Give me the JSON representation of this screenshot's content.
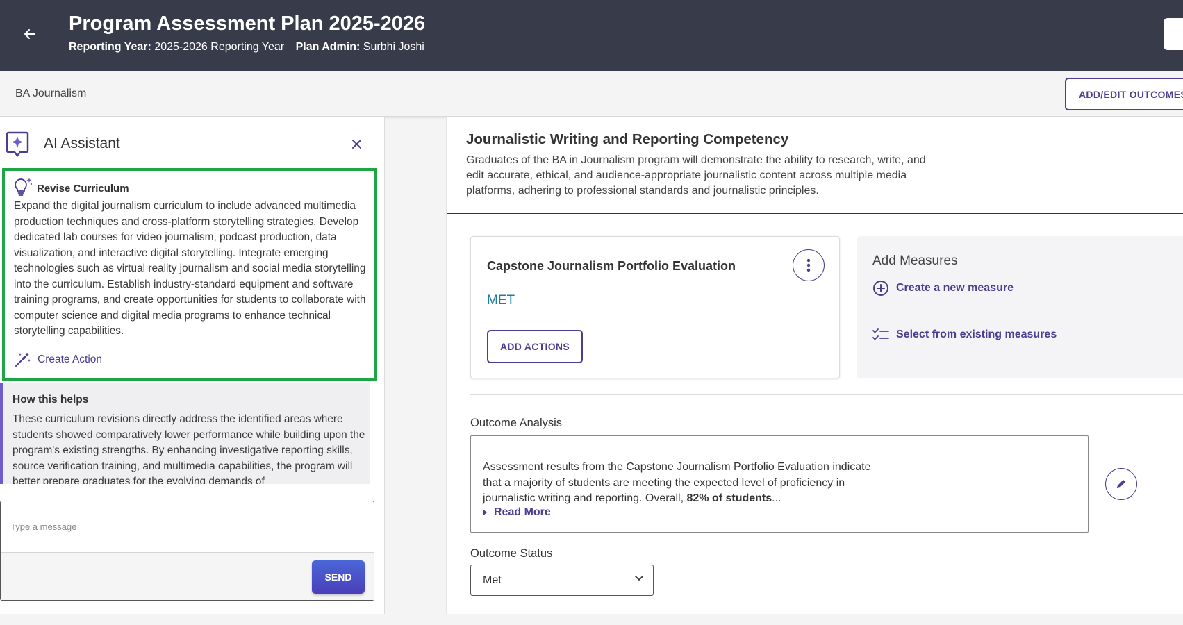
{
  "header": {
    "title": "Program Assessment Plan 2025-2026",
    "reporting_year_label": "Reporting Year:",
    "reporting_year_value": "2025-2026 Reporting Year",
    "plan_admin_label": "Plan Admin:",
    "plan_admin_value": "Surbhi Joshi"
  },
  "subbar": {
    "program_name": "BA Journalism",
    "add_edit_outcomes_label": "ADD/EDIT OUTCOMES"
  },
  "ai_panel": {
    "title": "AI Assistant",
    "suggestion": {
      "title": "Revise Curriculum",
      "body": "Expand the digital journalism curriculum to include advanced multimedia production techniques and cross-platform storytelling strategies. Develop dedicated lab courses for video journalism, podcast production, data visualization, and interactive digital storytelling. Integrate emerging technologies such as virtual reality journalism and social media storytelling into the curriculum. Establish industry-standard equipment and software training programs, and create opportunities for students to collaborate with computer science and digital media programs to enhance technical storytelling capabilities.",
      "create_action_label": "Create Action"
    },
    "helps": {
      "title": "How this helps",
      "body": "These curriculum revisions directly address the identified areas where students showed comparatively lower performance while building upon the program's existing strengths. By enhancing investigative reporting skills, source verification training, and multimedia capabilities, the program will better prepare graduates for the evolving demands of"
    },
    "message": {
      "placeholder": "Type a message",
      "send_label": "SEND"
    }
  },
  "outcome": {
    "title": "Journalistic Writing and Reporting Competency",
    "description": "Graduates of the BA in Journalism program will demonstrate the ability to research, write, and edit accurate, ethical, and audience-appropriate journalistic content across multiple media platforms, adhering to professional standards and journalistic principles."
  },
  "measure": {
    "title": "Capstone Journalism Portfolio Evaluation",
    "status": "MET",
    "add_actions_label": "ADD ACTIONS"
  },
  "add_measures": {
    "title": "Add Measures",
    "create_label": "Create a new measure",
    "select_label": "Select from existing measures"
  },
  "analysis": {
    "label": "Outcome Analysis",
    "text_start": "Assessment results from the Capstone Journalism Portfolio Evaluation indicate that a majority of students are meeting the expected level of proficiency in journalistic writing and reporting. Overall, ",
    "text_bold": "82% of students",
    "text_ellipsis": "...",
    "read_more_label": "Read More"
  },
  "outcome_status": {
    "label": "Outcome Status",
    "selected": "Met"
  },
  "colors": {
    "accent": "#4b3d8f",
    "header_bg": "#383c4a",
    "highlight_border": "#1fa644",
    "status_met": "#1e7f9c"
  }
}
